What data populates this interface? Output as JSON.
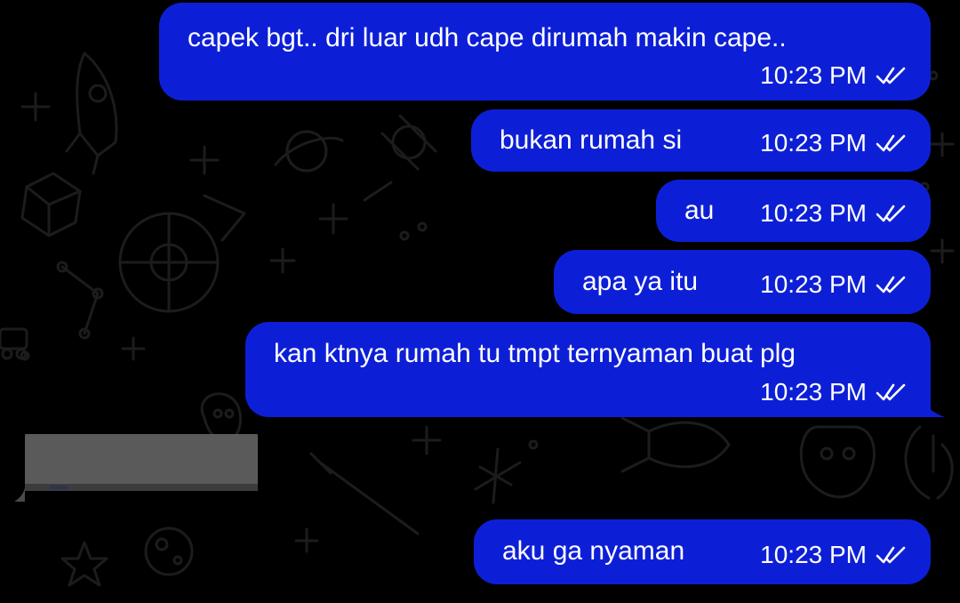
{
  "chat": {
    "messages": [
      {
        "text": "capek bgt.. dri luar udh cape dirumah makin cape..",
        "time": "10:23 PM",
        "status": "read",
        "direction": "outgoing"
      },
      {
        "text": "bukan rumah si",
        "time": "10:23 PM",
        "status": "read",
        "direction": "outgoing"
      },
      {
        "text": "au",
        "time": "10:23 PM",
        "status": "read",
        "direction": "outgoing"
      },
      {
        "text": "apa ya itu",
        "time": "10:23 PM",
        "status": "read",
        "direction": "outgoing"
      },
      {
        "text": "kan ktnya rumah tu tmpt ternyaman buat plg",
        "time": "10:23 PM",
        "status": "read",
        "direction": "outgoing"
      },
      {
        "text": "aku ga nyaman",
        "time": "10:23 PM",
        "status": "read",
        "direction": "outgoing"
      }
    ],
    "incoming_redacted": {
      "direction": "incoming",
      "content": "redacted"
    }
  },
  "theme": {
    "background": "#000000",
    "outgoing_bubble": "#0d1fd6",
    "text_color": "#ffffff",
    "read_tick_color": "#ffffff",
    "doodle_color": "#1b1b1b"
  },
  "icons": {
    "read_receipt": "double-check-icon",
    "wallpaper": "space-doodle-pattern"
  }
}
